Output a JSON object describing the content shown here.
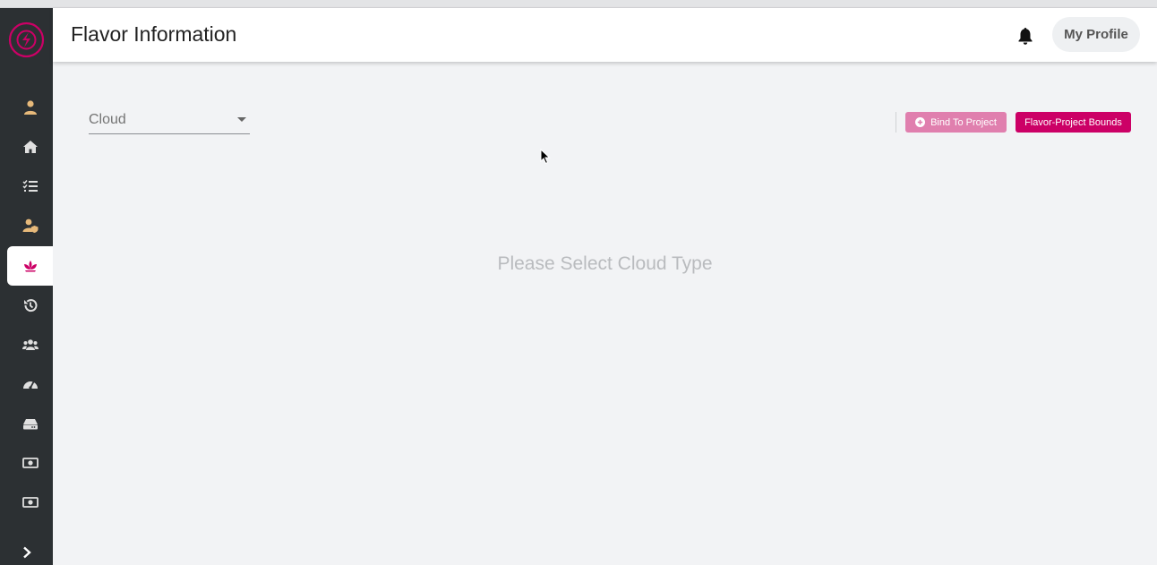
{
  "header": {
    "title": "Flavor Information",
    "profile_label": "My Profile"
  },
  "sidebar": {
    "items": [
      {
        "icon": "user-icon",
        "color": "#e7b97a"
      },
      {
        "icon": "home-icon",
        "color": "#e0e0e0"
      },
      {
        "icon": "checklist-icon",
        "color": "#e0e0e0"
      },
      {
        "icon": "user-shield-icon",
        "color": "#e7b97a"
      },
      {
        "icon": "flavor-lotus-icon",
        "color": "#cc0066",
        "active": true
      },
      {
        "icon": "history-icon",
        "color": "#e0e0e0"
      },
      {
        "icon": "users-icon",
        "color": "#e0e0e0"
      },
      {
        "icon": "dashboard-gauge-icon",
        "color": "#e0e0e0"
      },
      {
        "icon": "storage-drive-icon",
        "color": "#e0e0e0"
      },
      {
        "icon": "money-bill-icon",
        "color": "#e0e0e0"
      },
      {
        "icon": "money-bill-icon",
        "color": "#e0e0e0"
      }
    ],
    "expand_icon": "chevron-right-icon"
  },
  "filters": {
    "cloud_label": "Cloud"
  },
  "actions": {
    "bind_label": "Bind To Project",
    "bounds_label": "Flavor-Project Bounds"
  },
  "main": {
    "empty_message": "Please Select Cloud Type"
  },
  "colors": {
    "accent": "#cc0066",
    "accent_light": "#e07fae",
    "sidebar_bg": "#2c3033"
  }
}
